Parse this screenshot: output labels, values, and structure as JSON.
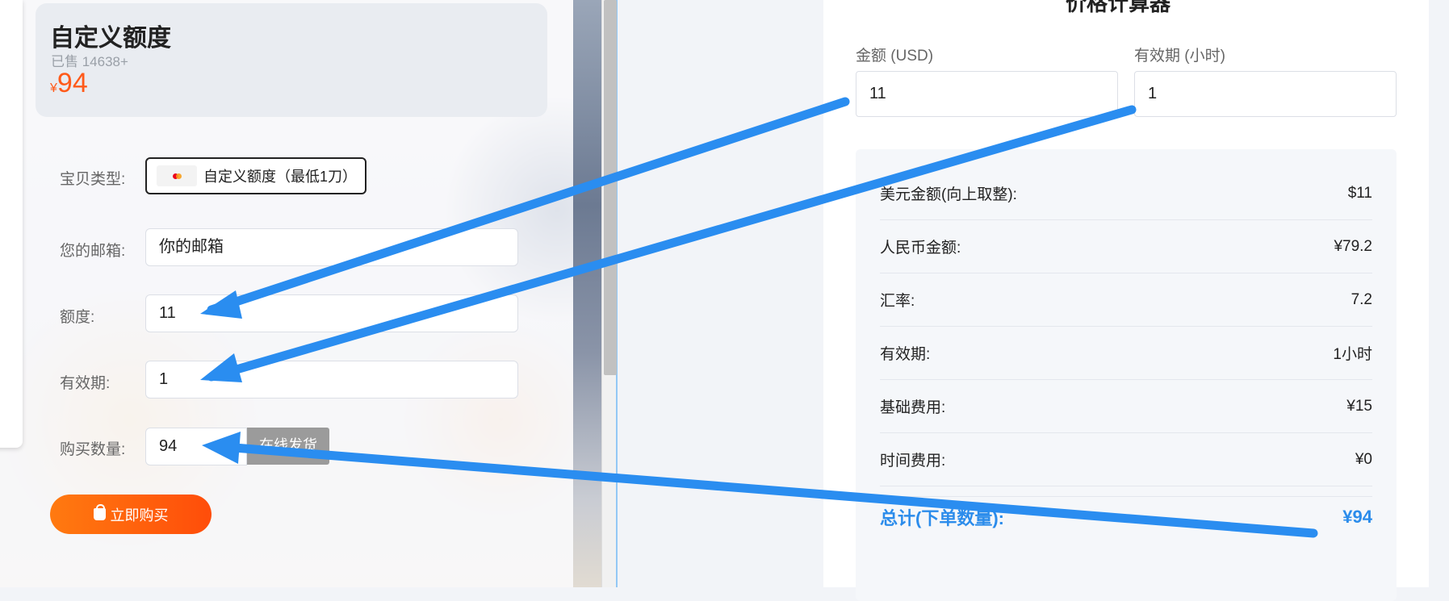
{
  "product": {
    "title": "自定义额度",
    "sold": "已售 14638+",
    "price_currency": "¥",
    "price": "94"
  },
  "form": {
    "type_label": "宝贝类型:",
    "type_value": "自定义额度（最低1刀）",
    "email_label": "您的邮箱:",
    "email_value": "你的邮箱",
    "quota_label": "额度:",
    "quota_value": "11",
    "validity_label": "有效期:",
    "validity_value": "1",
    "qty_label": "购买数量:",
    "qty_value": "94",
    "stock_button": "在线发货",
    "buy_button": "立即购买"
  },
  "calculator": {
    "title": "价格计算器",
    "amount_label": "金额 (USD)",
    "amount_value": "11",
    "hours_label": "有效期 (小时)",
    "hours_value": "1",
    "rows": [
      {
        "label": "美元金额(向上取整):",
        "value": "$11"
      },
      {
        "label": "人民币金额:",
        "value": "¥79.2"
      },
      {
        "label": "汇率:",
        "value": "7.2"
      },
      {
        "label": "有效期:",
        "value": "1小时"
      },
      {
        "label": "基础费用:",
        "value": "¥15"
      },
      {
        "label": "时间费用:",
        "value": "¥0"
      }
    ],
    "total_label": "总计(下单数量):",
    "total_value": "¥94"
  },
  "colors": {
    "price": "#ff5a1a",
    "arrow": "#2a8df0",
    "total": "#2b8ceb",
    "buy_button": "#ff5e0e"
  },
  "icons": [
    "card-icon",
    "shopping-bag-icon"
  ]
}
